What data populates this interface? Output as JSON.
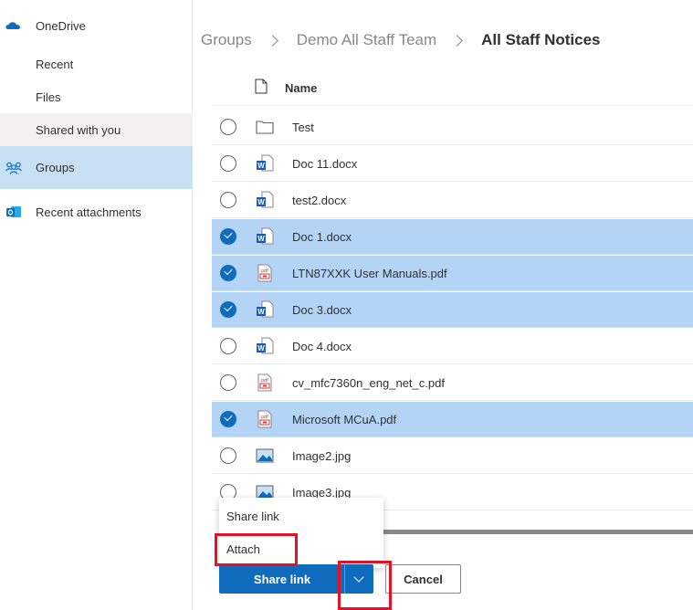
{
  "sidebar": {
    "items": [
      {
        "label": "OneDrive",
        "icon": "cloud-icon"
      },
      {
        "label": "Recent"
      },
      {
        "label": "Files"
      },
      {
        "label": "Shared with you"
      },
      {
        "label": "Groups",
        "icon": "groups-icon"
      },
      {
        "label": "Recent attachments",
        "icon": "outlook-icon"
      }
    ]
  },
  "breadcrumb": {
    "items": [
      "Groups",
      "Demo All Staff Team"
    ],
    "current": "All Staff Notices"
  },
  "list": {
    "column_name": "Name",
    "files": [
      {
        "name": "Test",
        "type": "folder",
        "selected": false
      },
      {
        "name": "Doc 11.docx",
        "type": "word",
        "selected": false
      },
      {
        "name": "test2.docx",
        "type": "word",
        "selected": false
      },
      {
        "name": "Doc 1.docx",
        "type": "word",
        "selected": true
      },
      {
        "name": "LTN87XXK User Manuals.pdf",
        "type": "pdf",
        "selected": true
      },
      {
        "name": "Doc 3.docx",
        "type": "word",
        "selected": true
      },
      {
        "name": "Doc 4.docx",
        "type": "word",
        "selected": false
      },
      {
        "name": "cv_mfc7360n_eng_net_c.pdf",
        "type": "pdf",
        "selected": false
      },
      {
        "name": "Microsoft MCuA.pdf",
        "type": "pdf",
        "selected": true
      },
      {
        "name": "Image2.jpg",
        "type": "image",
        "selected": false
      },
      {
        "name": "Image3.jpg",
        "type": "image",
        "selected": false
      }
    ]
  },
  "menu": {
    "share_link": "Share link",
    "attach": "Attach"
  },
  "buttons": {
    "primary": "Share link",
    "cancel": "Cancel"
  },
  "colors": {
    "accent": "#0f6cbd",
    "selected_row": "#b3d4f5",
    "annotation": "#e81123"
  }
}
